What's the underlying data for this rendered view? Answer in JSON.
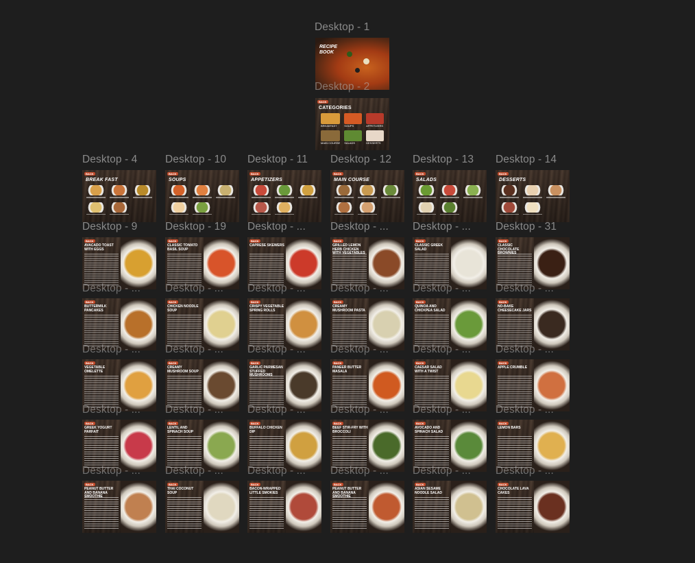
{
  "canvas_bg": "#1e1e1e",
  "pages": {
    "d1": {
      "label": "Desktop - 1",
      "title": "RECIPE BOOK"
    },
    "d2": {
      "label": "Desktop - 2",
      "title": "CATEGORIES",
      "captions": [
        "BREAKFAST",
        "SOUPS",
        "APPETIZERS",
        "MAIN COURSE",
        "SALADS",
        "DESSERTS"
      ]
    },
    "categories": [
      {
        "label": "Desktop - 4",
        "title": "BREAK FAST"
      },
      {
        "label": "Desktop - 10",
        "title": "SOUPS"
      },
      {
        "label": "Desktop - 11",
        "title": "APPETIZERS"
      },
      {
        "label": "Desktop - 12",
        "title": "MAIN COURSE"
      },
      {
        "label": "Desktop - 13",
        "title": "SALADS"
      },
      {
        "label": "Desktop - 14",
        "title": "DESSERTS"
      }
    ],
    "back_label": "BACK",
    "recipe_labels_row1": [
      "Desktop - 9",
      "Desktop - 19",
      "Desktop - ...",
      "Desktop - ...",
      "Desktop - ...",
      "Desktop - 31"
    ],
    "recipe_labels_overlap": [
      "Desktop - ...",
      "Desktop - ...",
      "Desktop - ...",
      "Desktop - ...",
      "Desktop - ...",
      "Desktop - ..."
    ],
    "recipes": [
      [
        "AVACADO TOAST WITH EGGS",
        "CLASSIC TOMATO BASIL SOUP",
        "CAPRESE SKEWERS",
        "GRILLED LEMON HERB CHICKEN WITH VEGETABLES",
        "CLASSIC GREEK SALAD",
        "CLASSIC CHOCOLATE BROWNIES"
      ],
      [
        "BUTTERMILK PANCAKES",
        "CHICKEN NOODLE SOUP",
        "CRISPY VEGETABLE SPRING ROLLS",
        "CREAMY MUSHROOM PASTA",
        "QUINOA AND CHICKPEA SALAD",
        "NO-BAKE CHEESECAKE JARS"
      ],
      [
        "VEGETABLE OMELETTE",
        "CREAMY MUSHROOM SOUP",
        "GARLIC PARMESAN STUFFED MUSHROOMS",
        "PANEER BUTTER MASALA",
        "CAESAR SALAD WITH A TWIST",
        "APPLE CRUMBLE"
      ],
      [
        "GREEK YOGURT PARFAIT",
        "LENTIL AND SPINACH SOUP",
        "BUFFALO CHICKEN DIP",
        "BEEF STIR-FRY WITH BROCCOLI",
        "AVOCADO AND SPINACH SALAD",
        "LEMON BARS"
      ],
      [
        "PEANUT BUTTER AND BANANA SMOOTHIE",
        "THAI COCONUT SOUP",
        "BACON-WRAPPED LITTLE SMOKIES",
        "PEANUT BUTTER AND BANANA SMOOTHIE",
        "ASIAN SESAME NOODLE SALAD",
        "CHOCOLATE LAVA CAKES"
      ]
    ]
  }
}
